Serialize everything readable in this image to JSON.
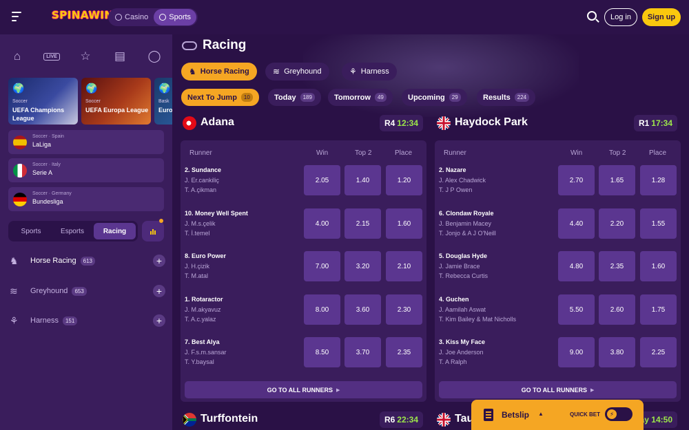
{
  "header": {
    "logo": "SPINAWIN",
    "modes": [
      "Casino",
      "Sports"
    ],
    "login": "Log in",
    "signup": "Sign up"
  },
  "sidebar": {
    "live_label": "LIVE",
    "promos": [
      {
        "sport": "Soccer",
        "name": "UEFA Champions League"
      },
      {
        "sport": "Soccer",
        "name": "UEFA Europa League"
      },
      {
        "sport": "Bask",
        "name": "Euro"
      }
    ],
    "leagues": [
      {
        "meta": "Soccer · Spain",
        "name": "LaLiga"
      },
      {
        "meta": "Soccer · Italy",
        "name": "Serie A"
      },
      {
        "meta": "Soccer · Germany",
        "name": "Bundesliga"
      }
    ],
    "tabs": [
      "Sports",
      "Esports",
      "Racing"
    ],
    "sports": [
      {
        "name": "Horse Racing",
        "count": "613"
      },
      {
        "name": "Greyhound",
        "count": "653"
      },
      {
        "name": "Harness",
        "count": "151"
      }
    ]
  },
  "main": {
    "title": "Racing",
    "race_types": [
      "Horse Racing",
      "Greyhound",
      "Harness"
    ],
    "time_tabs": [
      {
        "label": "Next To Jump",
        "count": "10"
      },
      {
        "label": "Today",
        "count": "189"
      },
      {
        "label": "Tomorrow",
        "count": "49"
      },
      {
        "label": "Upcoming",
        "count": "29"
      },
      {
        "label": "Results",
        "count": "224"
      }
    ],
    "columns": {
      "runner": "Runner",
      "win": "Win",
      "top2": "Top 2",
      "place": "Place"
    },
    "all_runners": "GO TO ALL RUNNERS",
    "venues": [
      {
        "name": "Adana",
        "race": "R4",
        "time": "12:34",
        "runners": [
          {
            "name": "2. Sundance",
            "jockey": "J. Er.cankiliç",
            "trainer": "T. A.çikman",
            "win": "2.05",
            "top2": "1.40",
            "place": "1.20"
          },
          {
            "name": "10. Money Well Spent",
            "jockey": "J. M.s.çelik",
            "trainer": "T. İ.temel",
            "win": "4.00",
            "top2": "2.15",
            "place": "1.60"
          },
          {
            "name": "8. Euro Power",
            "jockey": "J. H.çizik",
            "trainer": "T. M.atal",
            "win": "7.00",
            "top2": "3.20",
            "place": "2.10"
          },
          {
            "name": "1. Rotaractor",
            "jockey": "J. M.akyavuz",
            "trainer": "T. A.c.yalaz",
            "win": "8.00",
            "top2": "3.60",
            "place": "2.30"
          },
          {
            "name": "7. Best Alya",
            "jockey": "J. F.s.m.sansar",
            "trainer": "T. Y.baysal",
            "win": "8.50",
            "top2": "3.70",
            "place": "2.35"
          }
        ]
      },
      {
        "name": "Haydock Park",
        "race": "R1",
        "time": "17:34",
        "runners": [
          {
            "name": "2. Nazare",
            "jockey": "J. Alex Chadwick",
            "trainer": "T. J P Owen",
            "win": "2.70",
            "top2": "1.65",
            "place": "1.28"
          },
          {
            "name": "6. Clondaw Royale",
            "jockey": "J. Benjamin Macey",
            "trainer": "T. Jonjo & A J O'Neill",
            "win": "4.40",
            "top2": "2.20",
            "place": "1.55"
          },
          {
            "name": "5. Douglas Hyde",
            "jockey": "J. Jamie Brace",
            "trainer": "T. Rebecca Curtis",
            "win": "4.80",
            "top2": "2.35",
            "place": "1.60"
          },
          {
            "name": "4. Guchen",
            "jockey": "J. Aamilah Aswat",
            "trainer": "T. Kim Bailey & Mat Nicholls",
            "win": "5.50",
            "top2": "2.60",
            "place": "1.75"
          },
          {
            "name": "3. Kiss My Face",
            "jockey": "J. Joe Anderson",
            "trainer": "T. A Ralph",
            "win": "9.00",
            "top2": "3.80",
            "place": "2.25"
          }
        ]
      }
    ],
    "next_venues": [
      {
        "name": "Turffontein",
        "race": "R6",
        "time": "22:34"
      },
      {
        "name": "Tau",
        "race": "",
        "time": "ay 14:50"
      }
    ]
  },
  "betslip": {
    "label": "Betslip",
    "quick_bet": "QUICK BET"
  },
  "colors": {
    "accent": "#f5a623",
    "signup": "#f9c80e",
    "odds_button": "#5b3690",
    "card": "#3a1d5c",
    "time_green": "#9ce64a"
  }
}
